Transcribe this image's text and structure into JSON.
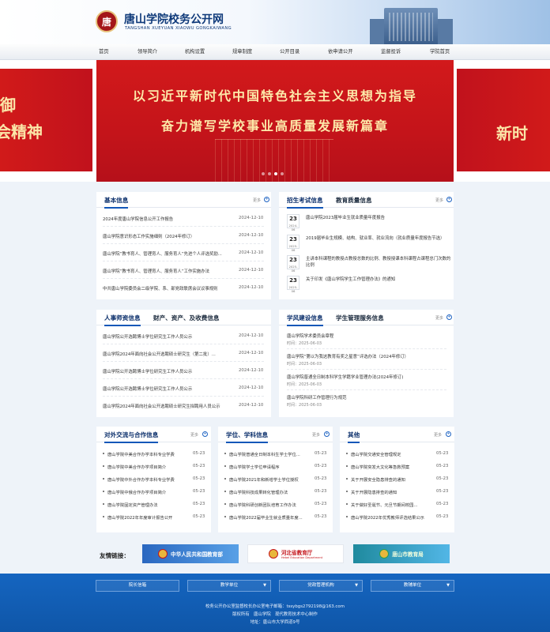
{
  "header": {
    "seal_char": "唐",
    "title": "唐山学院校务公开网",
    "pinyin": "TANGSHAN XUEYUAN XIAOWU GONGKAIWANG"
  },
  "nav": [
    "首页",
    "领导简介",
    "机构设置",
    "规章制度",
    "公开目录",
    "依申请公开",
    "监督投诉",
    "学院首页"
  ],
  "banner": {
    "line1": "以习近平新时代中国特色社会主义思想为指导",
    "line2": "奋力谱写学校事业高质量发展新篇章",
    "left_partial_1": "御",
    "left_partial_2": "会精神",
    "right_partial": "新时"
  },
  "more_label": "更多",
  "more_icon": "plus-circle-icon",
  "basic_info": {
    "title": "基本信息",
    "items": [
      {
        "title": "2024年度唐山学院信息公开工作报告",
        "date": "2024-12-10"
      },
      {
        "title": "唐山学院意识形态工作实施细则（2024年修订）",
        "date": "2024-12-10"
      },
      {
        "title": "唐山学院“教书育人、管理育人、服务育人”先进个人评选奖励...",
        "date": "2024-12-10"
      },
      {
        "title": "唐山学院“教书育人、管理育人、服务育人”工作实施办法",
        "date": "2024-12-10"
      },
      {
        "title": "中共唐山学院委员会二级学院、系、部党政联席会议议事规则",
        "date": "2024-12-10"
      }
    ]
  },
  "enroll_info": {
    "tabs": [
      "招生考试信息",
      "教育质量信息"
    ],
    "items": [
      {
        "day": "23",
        "month": "2024-06",
        "title": "唐山学院2023届毕业生就业质量年度报告"
      },
      {
        "day": "23",
        "month": "2025-06",
        "title": "2019届毕业生规模、结构、就业率、就业流向（就业质量年度报告节选）"
      },
      {
        "day": "23",
        "month": "2025-06",
        "title": "主讲本科课程的教授占教授总数的比例、教授授课本科课程占课程总门次数的比例"
      },
      {
        "day": "23",
        "month": "2025-06",
        "title": "关于印发《唐山学院学生工作管理办法》的通知"
      }
    ]
  },
  "personnel_info": {
    "tabs": [
      "人事师资信息",
      "财产、资产、及收费信息"
    ],
    "items": [
      {
        "title": "唐山学院公开选聘博士学位研究生工作人员公示",
        "date": "2024-12-10"
      },
      {
        "title": "唐山学院2024年面向社会公开选聘硕士研究生（第二批）...",
        "date": "2024-12-10"
      },
      {
        "title": "唐山学院公开选聘博士学位研究生工作人员公示",
        "date": "2024-12-10"
      },
      {
        "title": "唐山学院公开选聘博士学位研究生工作人员公示",
        "date": "2024-12-10"
      },
      {
        "title": "唐山学院2024年面向社会公开选聘硕士研究生拟聘用人员公示",
        "date": "2024-12-10"
      }
    ]
  },
  "conduct_info": {
    "tabs": [
      "学风建设信息",
      "学生管理服务信息"
    ],
    "time_label": "时间：",
    "items": [
      {
        "title": "唐山学院学术委员会章程",
        "time": "2025-06-03"
      },
      {
        "title": "唐山学院“第以为我这教育有奖之星意”评选办法（2024年修订）",
        "time": "2025-06-03"
      },
      {
        "title": "唐山学院普通全日制本科学生学籍学业管理办法(2024年修订)",
        "time": "2025-06-03"
      },
      {
        "title": "唐山学院科研工作管理行为规范",
        "time": "2025-06-03"
      }
    ]
  },
  "external_info": {
    "title": "对外交流与合作信息",
    "items": [
      {
        "title": "唐山学院中美合作办学本科专业学费",
        "date": "05-23"
      },
      {
        "title": "唐山学院中美合作办学项目简介",
        "date": "05-23"
      },
      {
        "title": "唐山学院中外合作办学本科专业学费",
        "date": "05-23"
      },
      {
        "title": "唐山学院中俄合作办学项目简介",
        "date": "05-23"
      },
      {
        "title": "唐山学院固定资产管理办法",
        "date": "05-23"
      },
      {
        "title": "唐山学院2022年年度审计报告公开",
        "date": "05-23"
      }
    ]
  },
  "discipline_info": {
    "title": "学位、学科信息",
    "items": [
      {
        "title": "唐山学院普通全日制本科生学士学位...",
        "date": "05-23"
      },
      {
        "title": "唐山学院学士学位申请程序",
        "date": "05-23"
      },
      {
        "title": "唐山学院2021年和新增学士学位授权",
        "date": "05-23"
      },
      {
        "title": "唐山学院科技成果转化管理办法",
        "date": "05-23"
      },
      {
        "title": "唐山学院科研创新团队培育工作办法",
        "date": "05-23"
      },
      {
        "title": "唐山学院2022届毕业生就业质量年度...",
        "date": "05-23"
      }
    ]
  },
  "other_info": {
    "title": "其他",
    "items": [
      {
        "title": "唐山学院交通安全管理规定",
        "date": "05-23"
      },
      {
        "title": "唐山学院突发大文化等急救预案",
        "date": "05-23"
      },
      {
        "title": "关于开展安全隐患排查的通知",
        "date": "05-23"
      },
      {
        "title": "关于开展隐患排查的通知",
        "date": "05-23"
      },
      {
        "title": "关于做好圣诞节、元旦节期间校园...",
        "date": "05-23"
      },
      {
        "title": "唐山学院2022年优秀教师评选结果公示",
        "date": "05-23"
      }
    ]
  },
  "links": {
    "label": "友情链接：",
    "items": [
      "中华人民共和国教育部",
      "河北省教育厅",
      "唐山市教育局"
    ],
    "hebei_sub": "Hebei Education Department"
  },
  "footer": {
    "selects": [
      "院长信箱",
      "教学单位",
      "党政管理机构",
      "教辅单位"
    ],
    "contact": "校务公开办公室监督校长办公室电子邮箱：tssybgs2792198@163.com",
    "copyright": "版权所有　唐山学院　现代教育技术中心制作",
    "address": "地址：唐山市大学西道9号"
  },
  "colors": {
    "brand_blue": "#1565c0",
    "banner_red": "#c4141a",
    "banner_gold": "#fde9a9"
  }
}
